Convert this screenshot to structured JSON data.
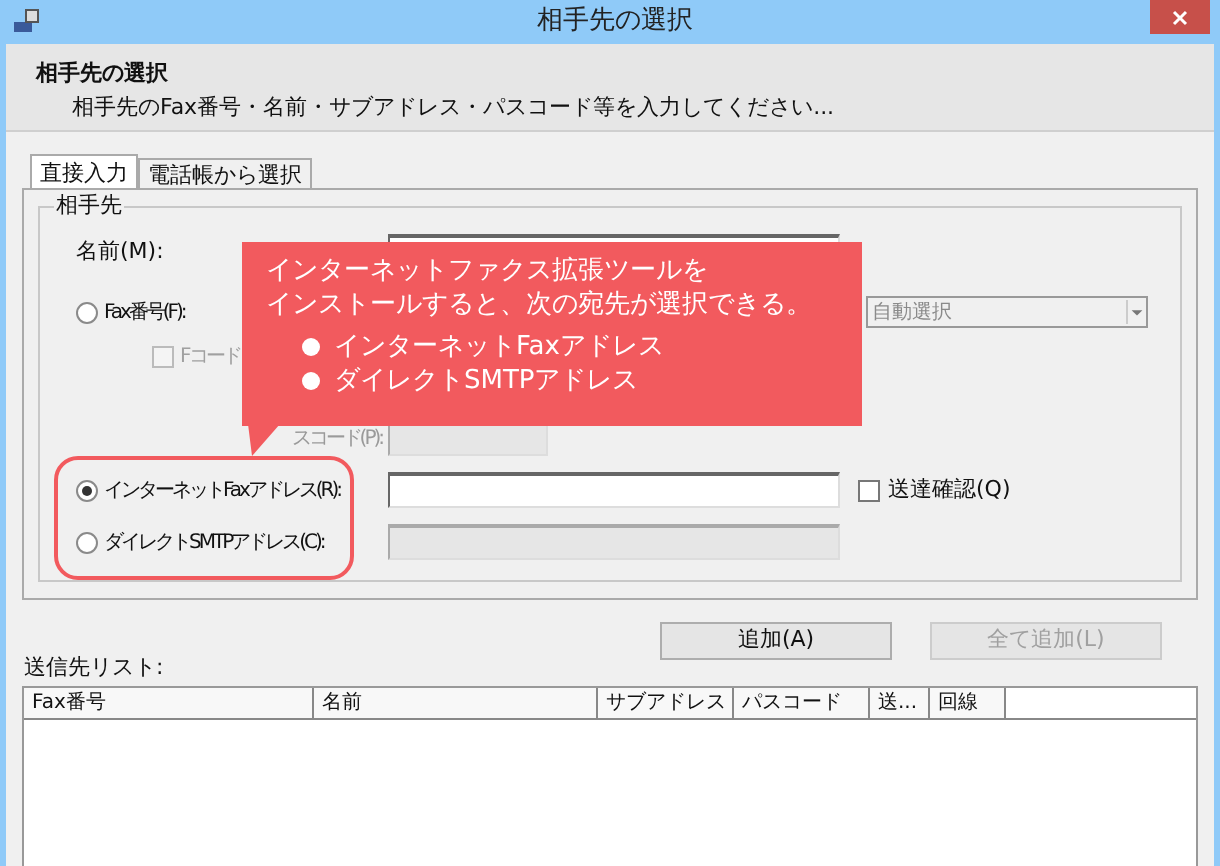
{
  "window": {
    "title": "相手先の選択"
  },
  "header": {
    "title": "相手先の選択",
    "description": "相手先のFax番号・名前・サブアドレス・パスコード等を入力してください..."
  },
  "tabs": [
    {
      "label": "直接入力",
      "selected": true
    },
    {
      "label": "電話帳から選択",
      "selected": false
    }
  ],
  "group": {
    "label": "相手先",
    "rows": [
      {
        "kind": "text",
        "label": "名前(M):",
        "disabled": false
      },
      {
        "kind": "radio",
        "label": "Fax番号(F):",
        "selected": false,
        "combo": "自動選択"
      },
      {
        "kind": "checkbox",
        "label": "Fコード",
        "checked": false
      },
      {
        "kind": "text",
        "label": "スコード(P):",
        "disabled": true
      },
      {
        "kind": "radio",
        "label": "インターネットFaxアドレス(R):",
        "selected": true,
        "field_disabled": false,
        "option": {
          "label": "送達確認(Q)",
          "checked": false
        }
      },
      {
        "kind": "radio",
        "label": "ダイレクトSMTPアドレス(C):",
        "selected": false,
        "field_disabled": true
      }
    ]
  },
  "callout": {
    "lines": [
      "インターネットファクス拡張ツールを",
      "インストールすると、次の宛先が選択できる。"
    ],
    "bullets": [
      "インターネットFaxアドレス",
      "ダイレクトSMTPアドレス"
    ]
  },
  "buttons": [
    {
      "label": "追加(A)",
      "disabled": false
    },
    {
      "label": "全て追加(L)",
      "disabled": true
    }
  ],
  "list": {
    "label": "送信先リスト:",
    "columns": [
      "Fax番号",
      "名前",
      "サブアドレス",
      "パスコード",
      "送...",
      "回線"
    ]
  }
}
